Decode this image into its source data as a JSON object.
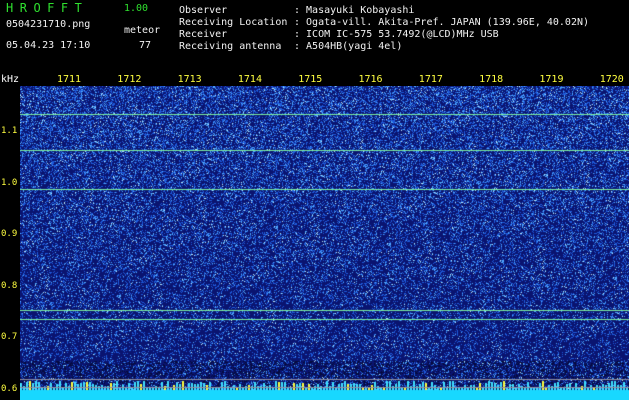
{
  "header": {
    "app_title": "HROFFT",
    "version": "1.00",
    "file_name": "0504231710.png",
    "mode": "meteor",
    "datetime": "05.04.23 17:10",
    "count": "77",
    "info": [
      {
        "label": "Observer",
        "value": ": Masayuki Kobayashi"
      },
      {
        "label": "Receiving Location",
        "value": ": Ogata-vill. Akita-Pref. JAPAN (139.96E, 40.02N)"
      },
      {
        "label": "Receiver",
        "value": ": ICOM IC-575 53.7492(@LCD)MHz USB"
      },
      {
        "label": "Receiving antenna",
        "value": ": A504HB(yagi 4el)"
      }
    ]
  },
  "spectrogram": {
    "unit": "kHz",
    "time_labels": [
      "1711",
      "1712",
      "1713",
      "1714",
      "1715",
      "1716",
      "1717",
      "1718",
      "1719",
      "1720"
    ],
    "freq_labels": [
      "1.1",
      "1.0",
      "0.9",
      "0.8",
      "0.7",
      "0.6"
    ],
    "freq_range_khz": [
      0.58,
      1.19
    ],
    "carrier_lines_khz": [
      1.135,
      1.065,
      0.99,
      0.755,
      0.737
    ],
    "colors": {
      "background": "#0a1470",
      "noise": "#2a6cff",
      "carrier": "#7cf0a0",
      "tick": "#ffff40"
    }
  }
}
